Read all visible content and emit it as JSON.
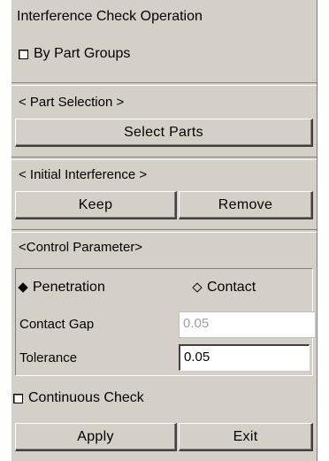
{
  "window": {
    "title": "Interference Check Operation"
  },
  "by_part_groups": {
    "label": "By Part Groups",
    "checked": false
  },
  "part_selection": {
    "header": "< Part Selection >",
    "select_button": "Select Parts"
  },
  "initial_interference": {
    "header": "< Initial Interference >",
    "keep_button": "Keep",
    "remove_button": "Remove"
  },
  "control_parameter": {
    "header": "<Control Parameter>",
    "mode_options": [
      {
        "label": "Penetration",
        "selected": true
      },
      {
        "label": "Contact",
        "selected": false
      }
    ],
    "contact_gap": {
      "label": "Contact Gap",
      "value": "0.05",
      "enabled": false
    },
    "tolerance": {
      "label": "Tolerance",
      "value": "0.05",
      "enabled": true
    }
  },
  "continuous_check": {
    "label": "Continuous Check",
    "checked": false
  },
  "actions": {
    "apply_button": "Apply",
    "exit_button": "Exit"
  }
}
